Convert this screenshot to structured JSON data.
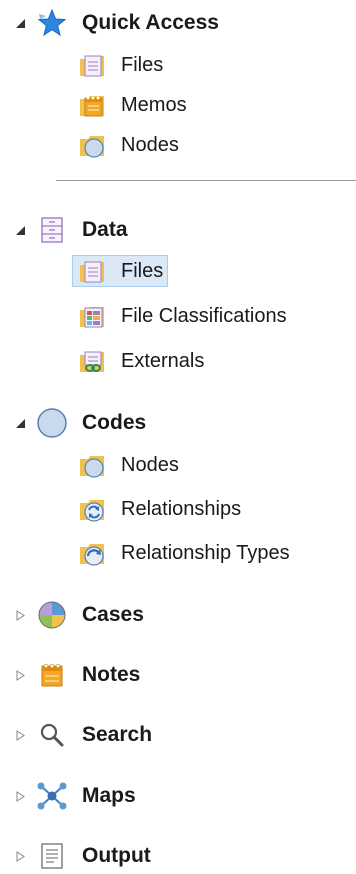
{
  "nav": {
    "quick_access": {
      "label": "Quick Access",
      "icon": "star-icon",
      "items": [
        {
          "label": "Files",
          "icon": "files-folder-icon"
        },
        {
          "label": "Memos",
          "icon": "memos-folder-icon"
        },
        {
          "label": "Nodes",
          "icon": "nodes-folder-icon"
        }
      ]
    },
    "data": {
      "label": "Data",
      "icon": "data-cabinet-icon",
      "items": [
        {
          "label": "Files",
          "icon": "files-folder-icon",
          "selected": true
        },
        {
          "label": "File Classifications",
          "icon": "file-classifications-icon"
        },
        {
          "label": "Externals",
          "icon": "externals-icon"
        }
      ]
    },
    "codes": {
      "label": "Codes",
      "icon": "codes-circle-icon",
      "items": [
        {
          "label": "Nodes",
          "icon": "nodes-folder-icon"
        },
        {
          "label": "Relationships",
          "icon": "relationships-icon"
        },
        {
          "label": "Relationship Types",
          "icon": "relationship-types-icon"
        }
      ]
    },
    "cases": {
      "label": "Cases",
      "icon": "cases-icon"
    },
    "notes": {
      "label": "Notes",
      "icon": "notes-icon"
    },
    "search": {
      "label": "Search",
      "icon": "search-icon"
    },
    "maps": {
      "label": "Maps",
      "icon": "maps-icon"
    },
    "output": {
      "label": "Output",
      "icon": "output-icon"
    }
  },
  "colors": {
    "selected_bg": "#dbe9f7",
    "folder_yellow": "#f2c24f",
    "star_blue": "#2f86e0"
  }
}
